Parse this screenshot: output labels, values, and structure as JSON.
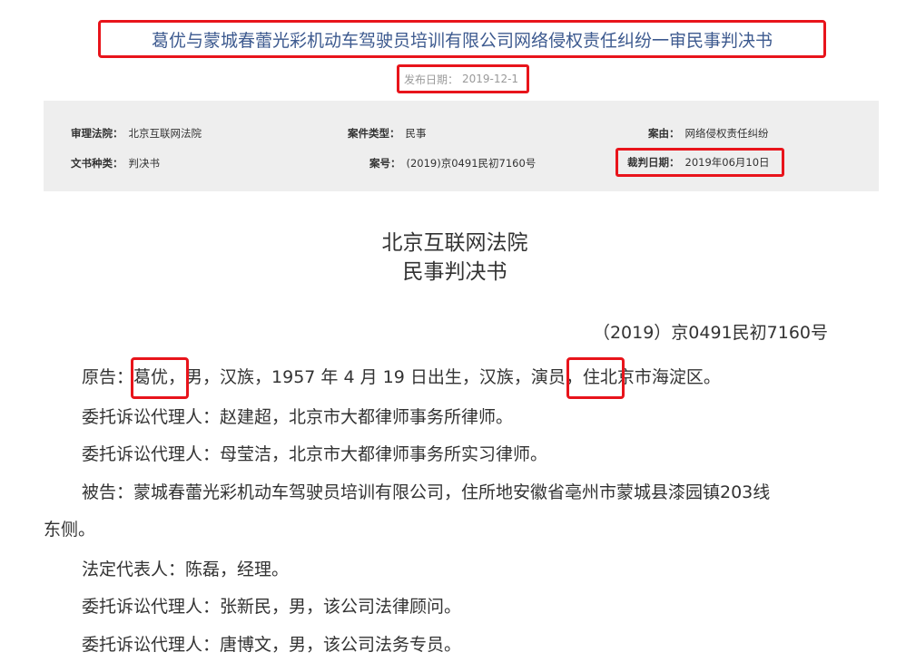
{
  "header": {
    "title": "葛优与蒙城春蕾光彩机动车驾驶员培训有限公司网络侵权责任纠纷一审民事判决书",
    "publish_label": "发布日期：",
    "publish_date": "2019-12-1"
  },
  "meta": {
    "court_label": "审理法院：",
    "court_value": "北京互联网法院",
    "case_type_label": "案件类型：",
    "case_type_value": "民事",
    "cause_label": "案由：",
    "cause_value": "网络侵权责任纠纷",
    "doc_type_label": "文书种类：",
    "doc_type_value": "判决书",
    "case_no_label": "案号：",
    "case_no_value": "(2019)京0491民初7160号",
    "judge_date_label": "裁判日期：",
    "judge_date_value": "2019年06月10日"
  },
  "document": {
    "court_name": "北京互联网法院",
    "doc_title": "民事判决书",
    "case_number": "（2019）京0491民初7160号",
    "plaintiff_prefix": "原告：",
    "plaintiff_name": "葛优",
    "plaintiff_mid": "，男，汉族，1957 年 4 月 19 日出生，汉族，",
    "plaintiff_occupation": "演员",
    "plaintiff_suffix": "，住北京市海淀区。",
    "agent1": "委托诉讼代理人：赵建超，北京市大都律师事务所律师。",
    "agent2": "委托诉讼代理人：母莹洁，北京市大都律师事务所实习律师。",
    "defendant_line1": "被告：蒙城春蕾光彩机动车驾驶员培训有限公司，住所地安徽省亳州市蒙城县漆园镇203线",
    "defendant_line2": "东侧。",
    "legal_rep": "法定代表人：陈磊，经理。",
    "agent3": "委托诉讼代理人：张新民，男，该公司法律顾问。",
    "agent4": "委托诉讼代理人：唐博文，男，该公司法务专员。"
  }
}
